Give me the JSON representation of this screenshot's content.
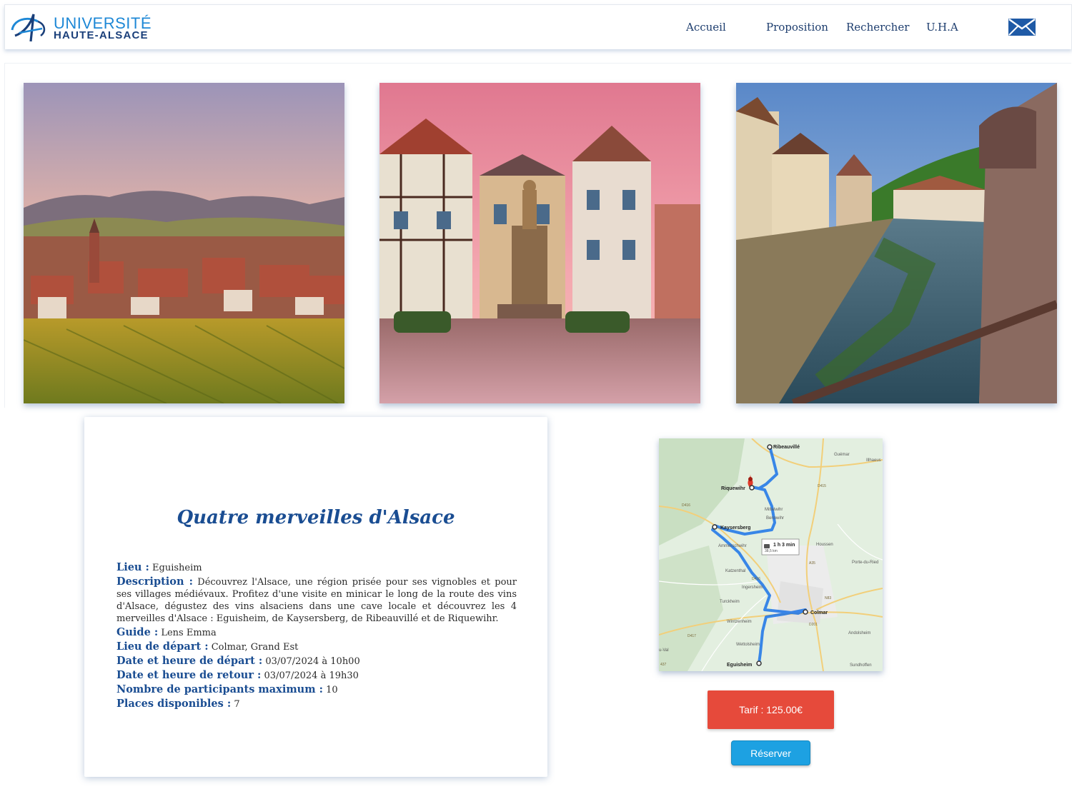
{
  "header": {
    "logo_line1": "UNIVERSITÉ",
    "logo_line2": "HAUTE-ALSACE",
    "nav": [
      {
        "label": "Accueil"
      },
      {
        "label": "Proposition"
      },
      {
        "label": "Rechercher"
      },
      {
        "label": "U.H.A"
      }
    ],
    "mail_icon": "envelope-icon"
  },
  "gallery": {
    "photos": [
      {
        "subject": "vineyard-village-panorama"
      },
      {
        "subject": "village-square-fountain"
      },
      {
        "subject": "river-through-village"
      }
    ]
  },
  "card": {
    "title": "Quatre merveilles d'Alsace",
    "lieu_label": "Lieu :",
    "lieu_value": "Eguisheim",
    "description_label": "Description :",
    "description_value": "Découvrez l'Alsace, une région prisée pour ses vignobles et pour ses villages médiévaux. Profitez d'une visite en minicar le long de la route des vins d'Alsace, dégustez des vins alsaciens dans une cave locale et découvrez les 4 merveilles d'Alsace : Eguisheim, de Kaysersberg, de Ribeauvillé et de Riquewihr.",
    "guide_label": "Guide :",
    "guide_value": "Lens Emma",
    "depart_lieu_label": "Lieu de départ :",
    "depart_lieu_value": "Colmar, Grand Est",
    "depart_date_label": "Date et heure de départ :",
    "depart_date_value": "03/07/2024 à 10h00",
    "retour_date_label": "Date et heure de retour :",
    "retour_date_value": "03/07/2024 à 19h30",
    "max_label": "Nombre de participants maximum :",
    "max_value": "10",
    "places_label": "Places disponibles :",
    "places_value": "7"
  },
  "map": {
    "places": {
      "ribeauville": "Ribeauvillé",
      "guemar": "Guémar",
      "illhaeusern": "Illhaeus",
      "riquewihr": "Riquewihr",
      "mittelwihr": "Mittelwihr",
      "bennwihr": "Bennwihr",
      "kaysersberg": "Kaysersberg",
      "ammerschwihr": "Ammerschwihr",
      "houssen": "Houssen",
      "portedurhin": "Porte-du-Ried",
      "katzenthal": "Katzenthal",
      "ingersheim": "Ingersheim",
      "turckheim": "Turckheim",
      "colmar": "Colmar",
      "wintzenheim": "Wintzenheim",
      "andolsheim": "Andolsheim",
      "wettolsheim": "Wettolsheim",
      "eguisheim": "Eguisheim",
      "sundhoffen": "Sundhoffen",
      "suval": "u-Val"
    },
    "roads": {
      "d416": "D416",
      "d415": "D415",
      "d417": "D417",
      "d416b": "D416",
      "n83": "N83",
      "d201": "D201",
      "a35": "A35",
      "d437": "437"
    },
    "route_duration": "1 h 3 min",
    "route_distance": "38,5 km",
    "route_color": "#1a73e8"
  },
  "pricing": {
    "tarif_label": "Tarif : 125.00€",
    "reserve_label": "Réserver",
    "tarif_color": "#e64a3b",
    "reserve_color": "#1da1e2"
  }
}
